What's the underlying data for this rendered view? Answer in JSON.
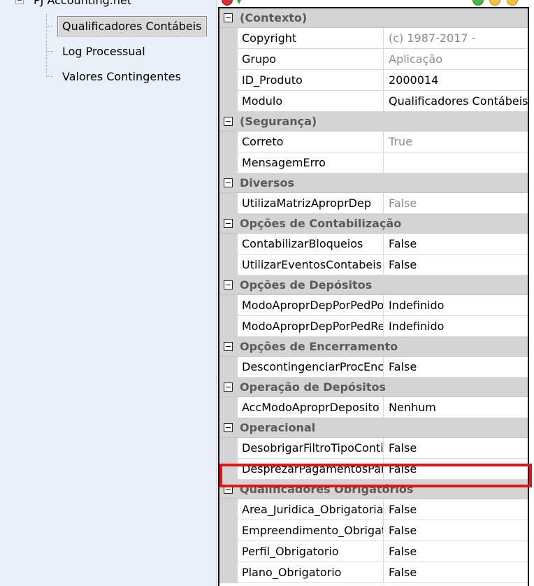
{
  "tree": {
    "root_label": "PJ Accounting.net",
    "items": [
      {
        "label": "Qualificadores Contábeis",
        "selected": true
      },
      {
        "label": "Log Processual",
        "selected": false
      },
      {
        "label": "Valores Contingentes",
        "selected": false
      }
    ]
  },
  "property_grid": {
    "categories": [
      {
        "label": "(Contexto)",
        "rows": [
          {
            "name": "Copyright",
            "value": "(c) 1987-2017 -",
            "readonly": true
          },
          {
            "name": "Grupo",
            "value": "Aplicação",
            "readonly": true
          },
          {
            "name": "ID_Produto",
            "value": "2000014",
            "readonly": false
          },
          {
            "name": "Modulo",
            "value": "Qualificadores Contábeis",
            "readonly": false
          }
        ]
      },
      {
        "label": "(Segurança)",
        "rows": [
          {
            "name": "Correto",
            "value": "True",
            "readonly": true
          },
          {
            "name": "MensagemErro",
            "value": "",
            "readonly": false
          }
        ]
      },
      {
        "label": "Diversos",
        "rows": [
          {
            "name": "UtilizaMatrizAproprDep",
            "value": "False",
            "readonly": true
          }
        ]
      },
      {
        "label": "Opções de Contabilização",
        "rows": [
          {
            "name": "ContabilizarBloqueios",
            "value": "False",
            "readonly": false
          },
          {
            "name": "UtilizarEventosContabeis",
            "value": "False",
            "readonly": false
          }
        ]
      },
      {
        "label": "Opções de Depósitos",
        "rows": [
          {
            "name": "ModoAproprDepPorPedPo",
            "value": "Indefinido",
            "readonly": false
          },
          {
            "name": "ModoAproprDepPorPedRe",
            "value": "Indefinido",
            "readonly": false
          }
        ]
      },
      {
        "label": "Opções de Encerramento",
        "rows": [
          {
            "name": "DescontingenciarProcEnc",
            "value": "False",
            "readonly": false
          }
        ]
      },
      {
        "label": "Operação de Depósitos",
        "rows": [
          {
            "name": "AccModoAproprDeposito",
            "value": "Nenhum",
            "readonly": false
          }
        ]
      },
      {
        "label": "Operacional",
        "rows": [
          {
            "name": "DesobrigarFiltroTipoConti",
            "value": "False",
            "readonly": false
          },
          {
            "name": "DesprezarPagamentosPar",
            "value": "False",
            "readonly": false
          }
        ]
      },
      {
        "label": "Qualificadores Obrigatórios",
        "rows": [
          {
            "name": "Area_Juridica_Obrigatoria",
            "value": "False",
            "readonly": false
          },
          {
            "name": "Empreendimento_Obrigat",
            "value": "False",
            "readonly": false
          },
          {
            "name": "Perfil_Obrigatorio",
            "value": "False",
            "readonly": false
          },
          {
            "name": "Plano_Obrigatorio",
            "value": "False",
            "readonly": false
          }
        ]
      }
    ]
  },
  "colors": {
    "highlight": "#e3121b",
    "category_bg": "#d4d4d4",
    "readonly_text": "#8c8c8c"
  }
}
